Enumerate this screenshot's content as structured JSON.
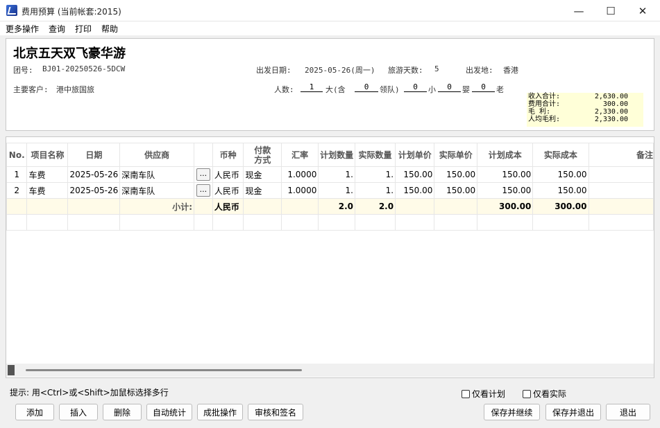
{
  "window": {
    "title": "费用预算 (当前帐套:2015)",
    "minimize": "—",
    "maximize": "☐",
    "close": "✕"
  },
  "menu": [
    "更多操作",
    "查询",
    "打印",
    "帮助"
  ],
  "header": {
    "tour_name": "北京五天双飞豪华游",
    "group_no_label": "团号:",
    "group_no": "BJ01-20250526-5DCW",
    "depart_date_label": "出发日期:",
    "depart_date": "2025-05-26(周一)",
    "days_label": "旅游天数:",
    "days": "5",
    "depart_place_label": "出发地:",
    "depart_place": "香港",
    "customer_label": "主要客户:",
    "customer": "港中旅国旅",
    "people_label": "人数:",
    "people": "1",
    "adult_label": "大(含",
    "leader": "0",
    "leader_label": "领队)",
    "child": "0",
    "child_label": "小",
    "infant": "0",
    "infant_label": "婴",
    "elder": "0",
    "elder_label": "老"
  },
  "summary": [
    {
      "label": "收入合计:",
      "value": "2,630.00"
    },
    {
      "label": "费用合计:",
      "value": "300.00"
    },
    {
      "label": "毛    利:",
      "value": "2,330.00"
    },
    {
      "label": "人均毛利:",
      "value": "2,330.00"
    }
  ],
  "table": {
    "columns": [
      "No.",
      "项目名称",
      "日期",
      "供应商",
      "",
      "币种",
      "付款\n方式",
      "汇率",
      "计划数量",
      "实际数量",
      "计划单价",
      "实际单价",
      "计划成本",
      "实际成本",
      "备注"
    ],
    "rows": [
      {
        "no": "1",
        "item": "车费",
        "date": "2025-05-26",
        "supplier": "深南车队",
        "btn": "...",
        "currency": "人民币",
        "pay": "现金",
        "rate": "1.0000",
        "plan_qty": "1.",
        "act_qty": "1.",
        "plan_price": "150.00",
        "act_price": "150.00",
        "plan_cost": "150.00",
        "act_cost": "150.00"
      },
      {
        "no": "2",
        "item": "车费",
        "date": "2025-05-26",
        "supplier": "深南车队",
        "btn": "...",
        "currency": "人民币",
        "pay": "现金",
        "rate": "1.0000",
        "plan_qty": "1.",
        "act_qty": "1.",
        "plan_price": "150.00",
        "act_price": "150.00",
        "plan_cost": "150.00",
        "act_cost": "150.00"
      }
    ],
    "subtotal": {
      "label": "小计:",
      "currency": "人民币",
      "plan_qty": "2.0",
      "act_qty": "2.0",
      "plan_cost": "300.00",
      "act_cost": "300.00"
    }
  },
  "footer": {
    "hint": "提示: 用<Ctrl>或<Shift>加鼠标选择多行",
    "only_plan": "仅看计划",
    "only_actual": "仅看实际",
    "buttons": {
      "add": "添加",
      "insert": "插入",
      "delete": "删除",
      "auto_stat": "自动统计",
      "batch": "成批操作",
      "audit": "审核和签名",
      "save_continue": "保存并继续",
      "save_exit": "保存并退出",
      "exit": "退出"
    }
  }
}
